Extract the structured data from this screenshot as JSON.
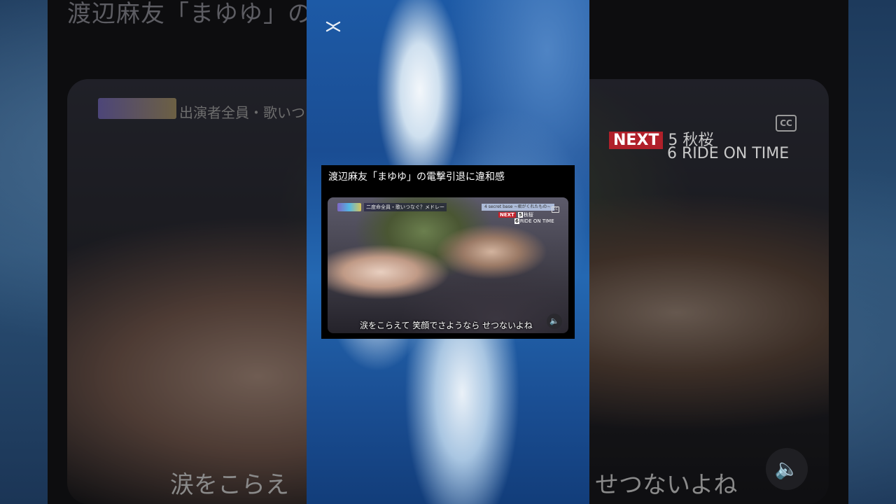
{
  "background": {
    "title": "渡辺麻友「まゆゆ」の電撃引退に違和感",
    "left_banner": "出演者全員・歌いつな",
    "next_label": "NEXT",
    "next_items": [
      "5 秋桜",
      "6 RIDE ON TIME"
    ],
    "cc_label": "CC",
    "subtitle_left": "涙をこらえ",
    "subtitle_right": "せつないよね"
  },
  "shorts": {
    "card_title": "渡辺麻友「まゆゆ」の電撃引退に違和感",
    "video": {
      "topic_banner": "二度命全員・歌いつなぐ？メドレー",
      "song_banner": "4 secret base ~君がくれたもの~",
      "cc_label": "CC",
      "next_label": "NEXT",
      "next_items": [
        {
          "num": "5",
          "title": "秋桜"
        },
        {
          "num": "6",
          "title": "RIDE ON TIME"
        }
      ],
      "subtitle": "涙をこらえて 笑顔でさようなら せつないよね"
    }
  },
  "icons": {
    "capcut_logo": "capcut-logo-icon",
    "speaker": "speaker-icon"
  }
}
